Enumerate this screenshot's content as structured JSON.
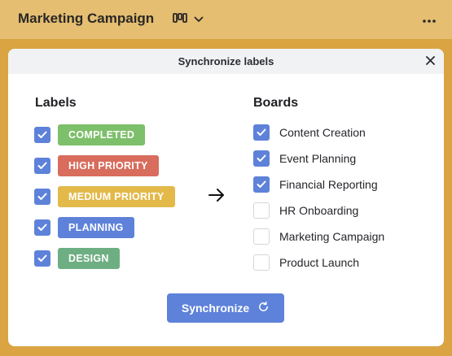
{
  "board": {
    "title": "Marketing Campaign",
    "switch_icon": "board-view-icon",
    "dropdown_icon": "chevron-down-icon",
    "more_icon": "more-dots-icon"
  },
  "modal": {
    "title": "Synchronize labels",
    "close_icon": "close-icon",
    "labels_heading": "Labels",
    "boards_heading": "Boards",
    "labels": [
      {
        "text": "COMPLETED",
        "checked": true,
        "color": "#7dbf6a"
      },
      {
        "text": "HIGH PRIORITY",
        "checked": true,
        "color": "#d86c5d"
      },
      {
        "text": "MEDIUM PRIORITY",
        "checked": true,
        "color": "#e3b94a"
      },
      {
        "text": "PLANNING",
        "checked": true,
        "color": "#5e82d9"
      },
      {
        "text": "DESIGN",
        "checked": true,
        "color": "#6eae83"
      }
    ],
    "boards": [
      {
        "name": "Content Creation",
        "checked": true
      },
      {
        "name": "Event Planning",
        "checked": true
      },
      {
        "name": "Financial Reporting",
        "checked": true
      },
      {
        "name": "HR Onboarding",
        "checked": false
      },
      {
        "name": "Marketing Campaign",
        "checked": false
      },
      {
        "name": "Product Launch",
        "checked": false
      }
    ],
    "arrow_icon": "arrow-right-icon",
    "sync_button": {
      "label": "Synchronize",
      "icon": "refresh-icon"
    }
  },
  "colors": {
    "accent": "#5e82d9",
    "background": "#d9a441",
    "topbar": "#e5be72"
  }
}
